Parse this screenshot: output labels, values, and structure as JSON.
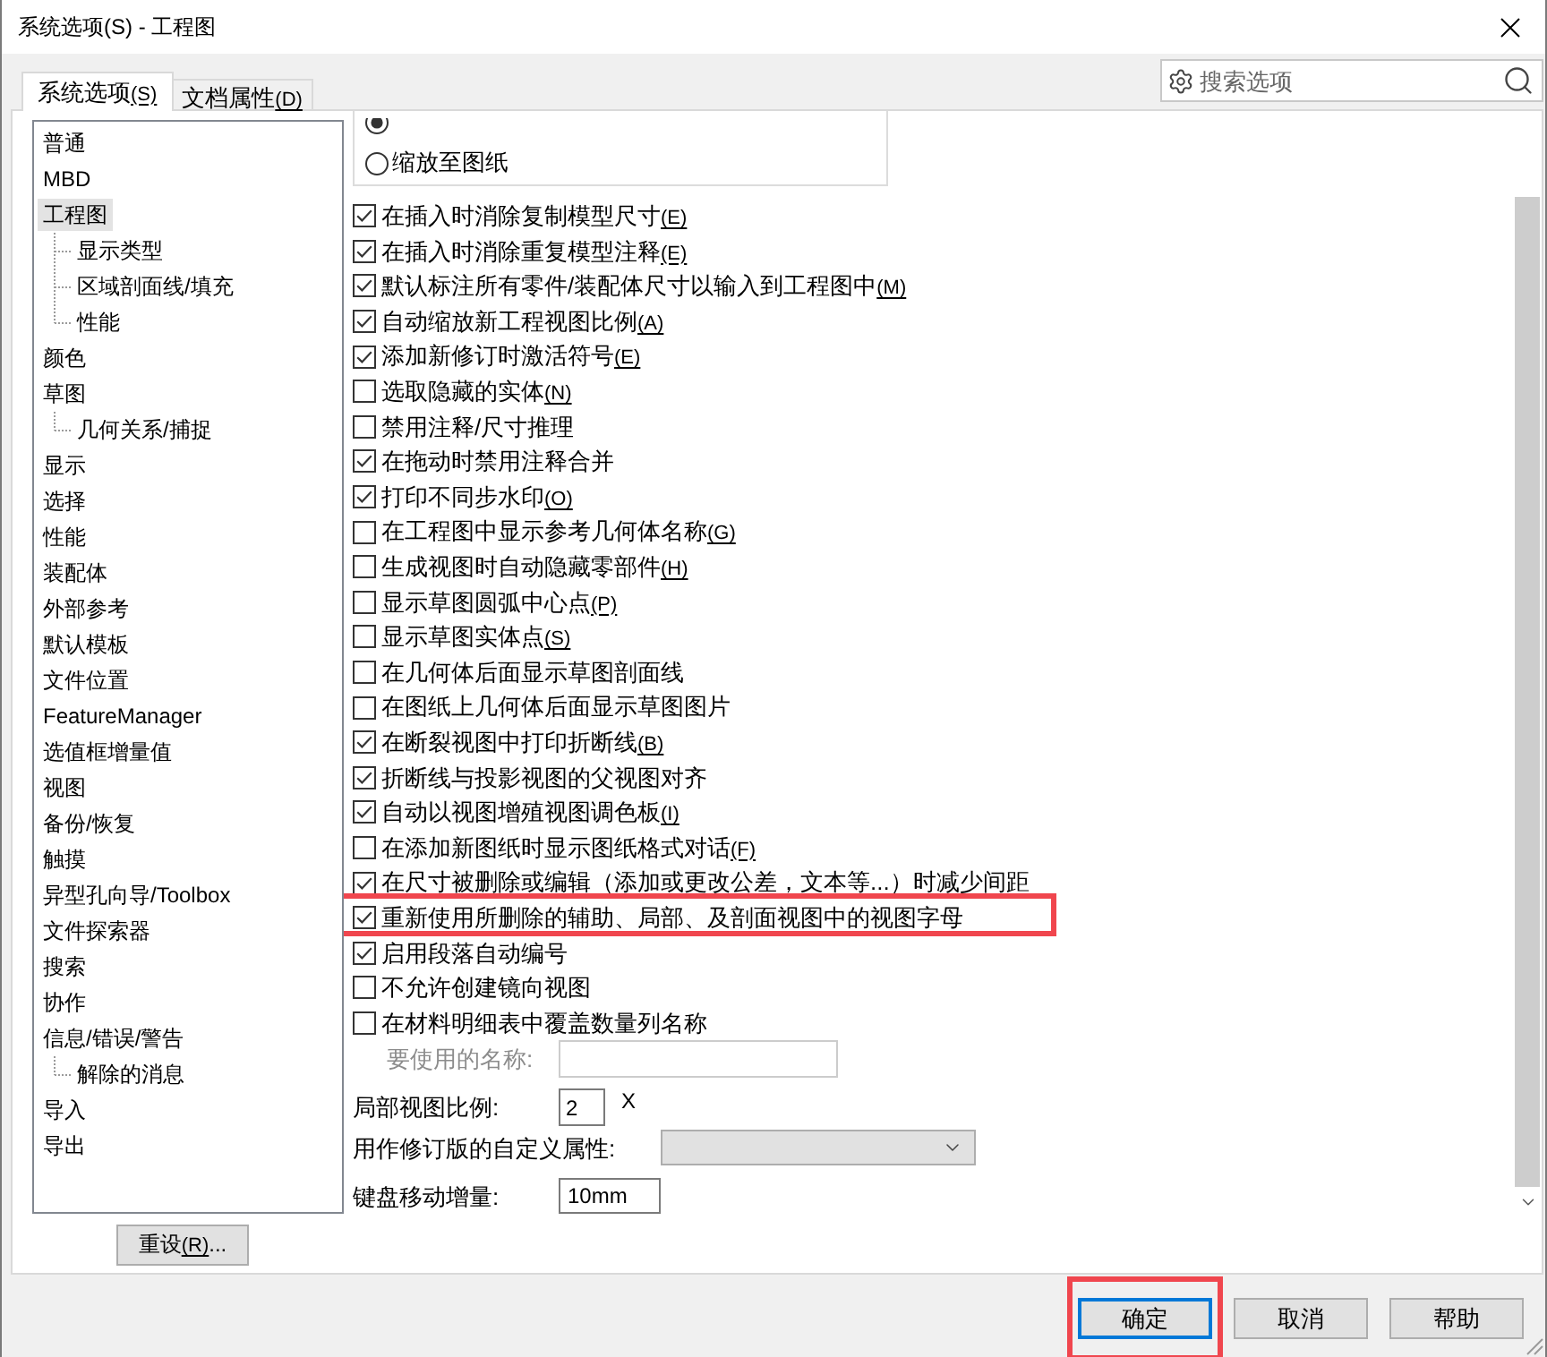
{
  "window": {
    "title": "系统选项(S) - 工程图"
  },
  "tabs": [
    {
      "label": "系统选项",
      "accel": "(S)",
      "selected": true
    },
    {
      "label": "文档属性",
      "accel": "(D)",
      "selected": false
    }
  ],
  "search": {
    "placeholder": "搜索选项"
  },
  "sidebar": {
    "items": [
      {
        "label": "普通",
        "selected": false
      },
      {
        "label": "MBD",
        "selected": false
      },
      {
        "label": "工程图",
        "selected": true,
        "children": [
          {
            "label": "显示类型",
            "selected": false
          },
          {
            "label": "区域剖面线/填充",
            "selected": false
          },
          {
            "label": "性能",
            "selected": false
          }
        ]
      },
      {
        "label": "颜色",
        "selected": false
      },
      {
        "label": "草图",
        "selected": false,
        "children": [
          {
            "label": "几何关系/捕捉",
            "selected": false
          }
        ]
      },
      {
        "label": "显示",
        "selected": false
      },
      {
        "label": "选择",
        "selected": false
      },
      {
        "label": "性能",
        "selected": false
      },
      {
        "label": "装配体",
        "selected": false
      },
      {
        "label": "外部参考",
        "selected": false
      },
      {
        "label": "默认模板",
        "selected": false
      },
      {
        "label": "文件位置",
        "selected": false
      },
      {
        "label": "FeatureManager",
        "selected": false
      },
      {
        "label": "选值框增量值",
        "selected": false
      },
      {
        "label": "视图",
        "selected": false
      },
      {
        "label": "备份/恢复",
        "selected": false
      },
      {
        "label": "触摸",
        "selected": false
      },
      {
        "label": "异型孔向导/Toolbox",
        "selected": false
      },
      {
        "label": "文件探索器",
        "selected": false
      },
      {
        "label": "搜索",
        "selected": false
      },
      {
        "label": "协作",
        "selected": false
      },
      {
        "label": "信息/错误/警告",
        "selected": false,
        "children": [
          {
            "label": "解除的消息",
            "selected": false
          }
        ]
      },
      {
        "label": "导入",
        "selected": false
      },
      {
        "label": "导出",
        "selected": false
      }
    ]
  },
  "reset_button": {
    "label": "重设",
    "accel": "(R)",
    "suffix": "..."
  },
  "display_group": {
    "radios": [
      {
        "selected": true
      },
      {
        "label": "缩放至图纸",
        "selected": false
      }
    ]
  },
  "options": [
    {
      "label": "在插入时消除复制模型尺寸",
      "accel": "(E)",
      "checked": true,
      "highlighted": false
    },
    {
      "label": "在插入时消除重复模型注释",
      "accel": "(E)",
      "checked": true,
      "highlighted": false
    },
    {
      "label": "默认标注所有零件/装配体尺寸以输入到工程图中",
      "accel": "(M)",
      "checked": true,
      "highlighted": false
    },
    {
      "label": "自动缩放新工程视图比例",
      "accel": "(A)",
      "checked": true,
      "highlighted": false
    },
    {
      "label": "添加新修订时激活符号",
      "accel": "(E)",
      "checked": true,
      "highlighted": false
    },
    {
      "label": "选取隐藏的实体",
      "accel": "(N)",
      "checked": false,
      "highlighted": false
    },
    {
      "label": "禁用注释/尺寸推理",
      "checked": false,
      "highlighted": false
    },
    {
      "label": "在拖动时禁用注释合并",
      "checked": true,
      "highlighted": false
    },
    {
      "label": "打印不同步水印",
      "accel": "(O)",
      "checked": true,
      "highlighted": false
    },
    {
      "label": "在工程图中显示参考几何体名称",
      "accel": "(G)",
      "checked": false,
      "highlighted": false
    },
    {
      "label": "生成视图时自动隐藏零部件",
      "accel": "(H)",
      "checked": false,
      "highlighted": false
    },
    {
      "label": "显示草图圆弧中心点",
      "accel": "(P)",
      "checked": false,
      "highlighted": false
    },
    {
      "label": "显示草图实体点",
      "accel": "(S)",
      "checked": false,
      "highlighted": false
    },
    {
      "label": "在几何体后面显示草图剖面线",
      "checked": false,
      "highlighted": false
    },
    {
      "label": "在图纸上几何体后面显示草图图片",
      "checked": false,
      "highlighted": false
    },
    {
      "label": "在断裂视图中打印折断线",
      "accel": "(B)",
      "checked": true,
      "highlighted": false
    },
    {
      "label": "折断线与投影视图的父视图对齐",
      "checked": true,
      "highlighted": false
    },
    {
      "label": "自动以视图增殖视图调色板",
      "accel": "(I)",
      "checked": true,
      "highlighted": false
    },
    {
      "label": "在添加新图纸时显示图纸格式对话",
      "accel": "(F)",
      "checked": false,
      "highlighted": false
    },
    {
      "label": "在尺寸被删除或编辑（添加或更改公差，文本等...）时减少间距",
      "checked": true,
      "highlighted": false
    },
    {
      "label": "重新使用所删除的辅助、局部、及剖面视图中的视图字母",
      "checked": true,
      "highlighted": true
    },
    {
      "label": "启用段落自动编号",
      "checked": true,
      "highlighted": false
    },
    {
      "label": "不允许创建镜向视图",
      "checked": false,
      "highlighted": false
    },
    {
      "label": "在材料明细表中覆盖数量列名称",
      "checked": false,
      "highlighted": false
    }
  ],
  "name_field": {
    "label": "要使用的名称:",
    "disabled": true
  },
  "detail_scale": {
    "label": "局部视图比例:",
    "value": "2",
    "unit": "X"
  },
  "revision_property": {
    "label": "用作修订版的自定义属性:",
    "disabled": true
  },
  "keyboard_increment": {
    "label": "键盘移动增量:",
    "value": "10mm"
  },
  "buttons": [
    {
      "label": "确定",
      "focused": true,
      "highlighted": true
    },
    {
      "label": "取消",
      "focused": false,
      "highlighted": false
    },
    {
      "label": "帮助",
      "focused": false,
      "highlighted": false
    }
  ]
}
